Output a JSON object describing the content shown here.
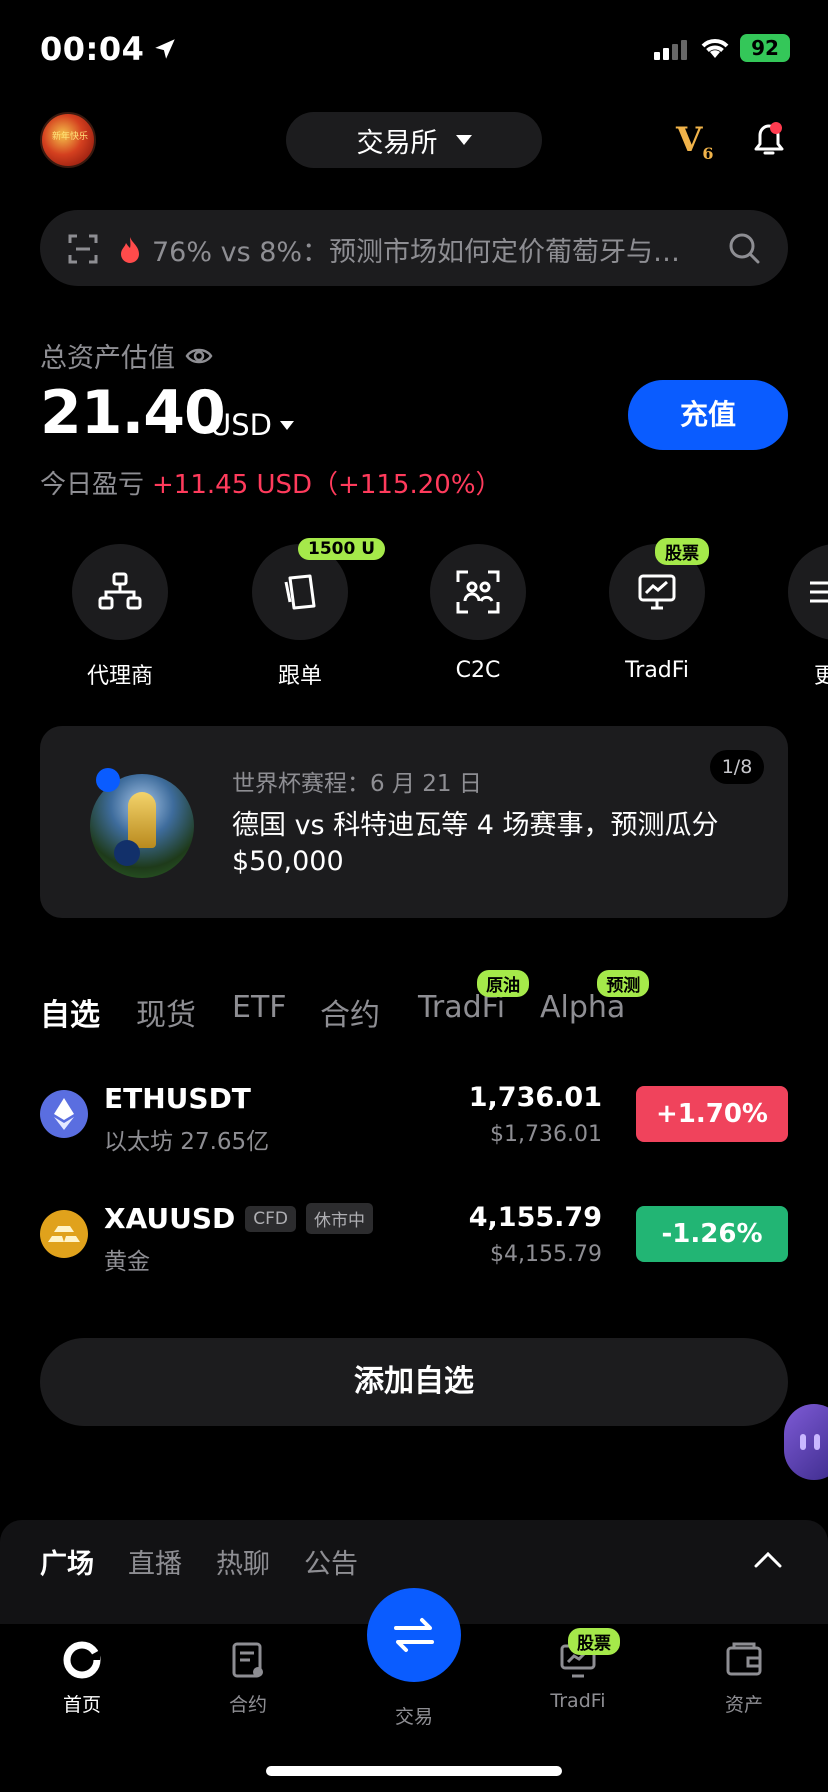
{
  "status_bar": {
    "time": "00:04",
    "battery": "92"
  },
  "header": {
    "avatar_text": "新年快乐",
    "exchange_label": "交易所",
    "vip_level_prefix": "V",
    "vip_level": "6"
  },
  "search": {
    "text": "76% vs 8%：预测市场如何定价葡萄牙与…"
  },
  "assets": {
    "label": "总资产估值",
    "value": "21.40",
    "unit": "USD",
    "pnl_label": "今日盈亏",
    "pnl_value": "+11.45 USD（+115.20%）",
    "deposit_label": "充值"
  },
  "shortcuts": [
    {
      "label": "代理商",
      "badge": ""
    },
    {
      "label": "跟单",
      "badge": "1500 U"
    },
    {
      "label": "C2C",
      "badge": ""
    },
    {
      "label": "TradFi",
      "badge": "股票"
    },
    {
      "label": "更",
      "badge": ""
    }
  ],
  "banner": {
    "subtitle": "世界杯赛程：6 月 21 日",
    "title": "德国 vs 科特迪瓦等 4 场赛事，预测瓜分 $50,000",
    "pager": "1/8"
  },
  "market_tabs": [
    {
      "label": "自选",
      "badge": ""
    },
    {
      "label": "现货",
      "badge": ""
    },
    {
      "label": "ETF",
      "badge": ""
    },
    {
      "label": "合约",
      "badge": ""
    },
    {
      "label": "TradFi",
      "badge": "原油"
    },
    {
      "label": "Alpha",
      "badge": "预测"
    }
  ],
  "watchlist": [
    {
      "symbol": "ETHUSDT",
      "name": "以太坊 27.65亿",
      "price": "1,736.01",
      "price_usd": "$1,736.01",
      "change": "+1.70%",
      "tags": []
    },
    {
      "symbol": "XAUUSD",
      "name": "黄金",
      "price": "4,155.79",
      "price_usd": "$4,155.79",
      "change": "-1.26%",
      "tags": [
        "CFD",
        "休市中"
      ]
    }
  ],
  "add_watchlist_label": "添加自选",
  "sheet_tabs": [
    "广场",
    "直播",
    "热聊",
    "公告"
  ],
  "nav": [
    {
      "label": "首页"
    },
    {
      "label": "合约"
    },
    {
      "label": "交易"
    },
    {
      "label": "TradFi",
      "badge": "股票"
    },
    {
      "label": "资产"
    }
  ],
  "colors": {
    "accent": "#0a5cff",
    "up": "#f0435c",
    "down": "#22b574",
    "badge": "#a5e94a",
    "vip": "#f0b34a"
  }
}
